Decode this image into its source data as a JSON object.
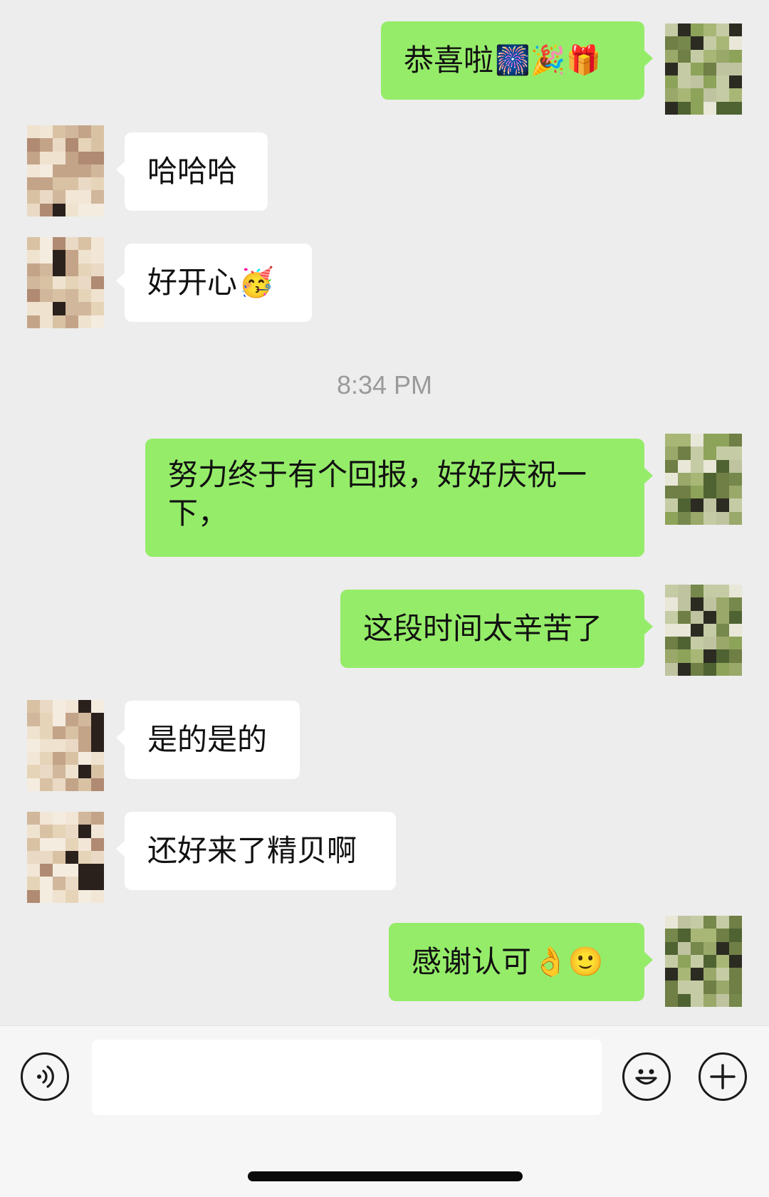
{
  "messages": [
    {
      "side": "out",
      "text": "恭喜啦",
      "emoji": "🎆🎉🎁"
    },
    {
      "side": "in",
      "text": "哈哈哈",
      "emoji": ""
    },
    {
      "side": "in",
      "text": "好开心",
      "emoji": "🥳"
    },
    {
      "side": "out",
      "text": "努力终于有个回报，好好庆祝一下，",
      "emoji": ""
    },
    {
      "side": "out",
      "text": "这段时间太辛苦了",
      "emoji": ""
    },
    {
      "side": "in",
      "text": "是的是的",
      "emoji": ""
    },
    {
      "side": "in",
      "text": "还好来了精贝啊",
      "emoji": ""
    },
    {
      "side": "out",
      "text": "感谢认可",
      "emoji": "👌🙂"
    }
  ],
  "timestamp": "8:34 PM",
  "input": {
    "value": "",
    "placeholder": ""
  },
  "icons": {
    "voice": "voice-icon",
    "emoji": "emoji-face-icon",
    "plus": "plus-icon"
  },
  "colors": {
    "background": "#ededed",
    "outgoing_bubble": "#95ec69",
    "incoming_bubble": "#ffffff",
    "input_bar": "#f6f6f6"
  }
}
